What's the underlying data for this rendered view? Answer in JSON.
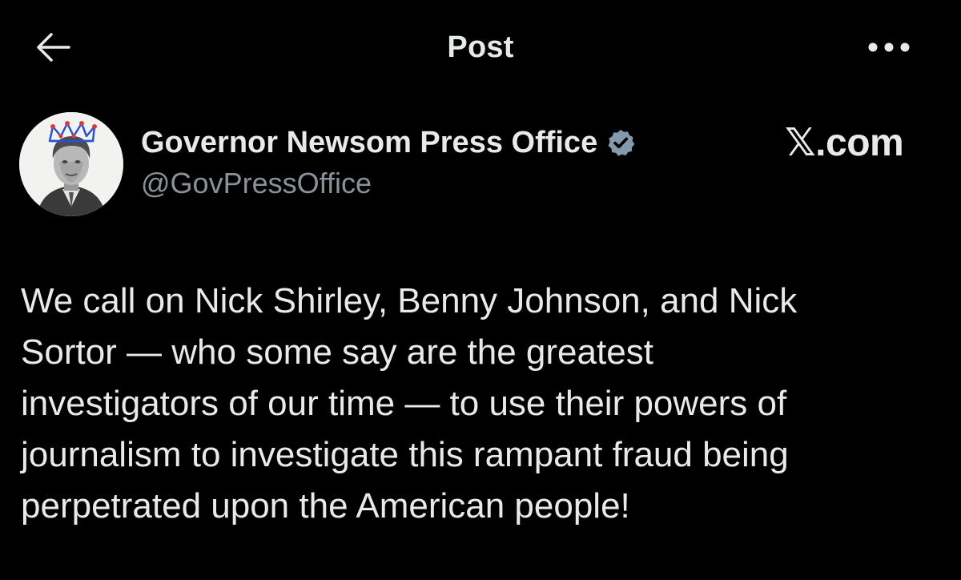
{
  "header": {
    "title": "Post",
    "back_icon": "arrow-left-icon",
    "more_icon": "more-horizontal-icon"
  },
  "author": {
    "display_name": "Governor Newsom Press Office",
    "handle": "@GovPressOffice",
    "verified": true,
    "verified_color": "#829aab"
  },
  "watermark": {
    "text": "𝕏.com"
  },
  "tweet": {
    "lines": [
      "We call on Nick Shirley, Benny Johnson, and Nick",
      "Sortor — who some say are the greatest",
      "investigators of our time — to use their powers of",
      "journalism to investigate this rampant fraud being",
      "perpetrated upon the American people!"
    ]
  },
  "colors": {
    "background": "#000000",
    "text_primary": "#e7e9ea",
    "text_secondary": "#8b9198"
  }
}
